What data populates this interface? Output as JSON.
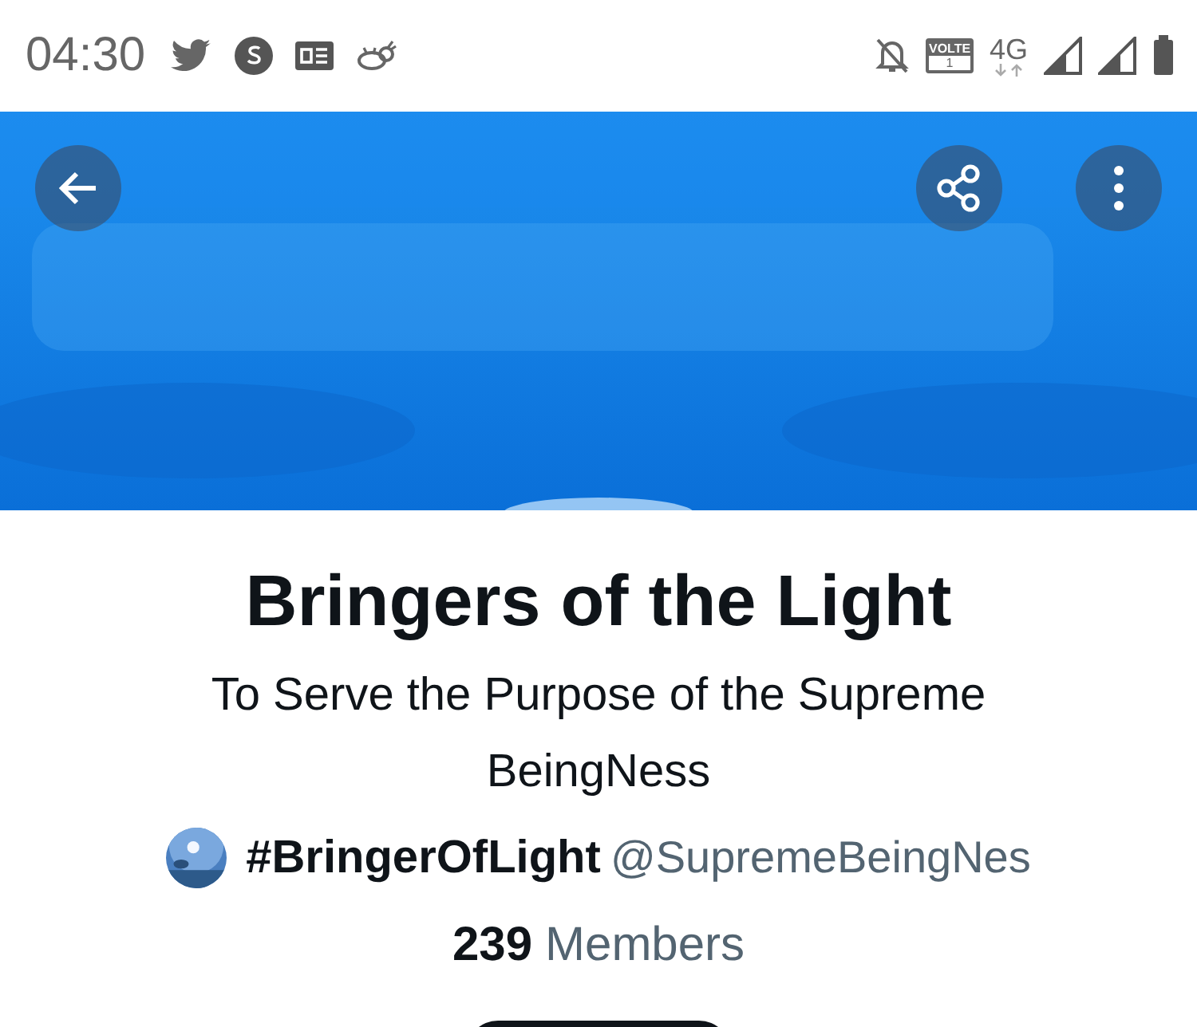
{
  "status_bar": {
    "time": "04:30",
    "volte": "VOLTE",
    "volte_sim": "1",
    "network": "4G"
  },
  "community": {
    "name": "Bringers of the Light",
    "description": "To Serve the Purpose of the Supreme BeingNess",
    "hashtag": "#BringerOfLight",
    "handle": "@SupremeBeingNes",
    "member_count": "239",
    "member_label": "Members"
  }
}
